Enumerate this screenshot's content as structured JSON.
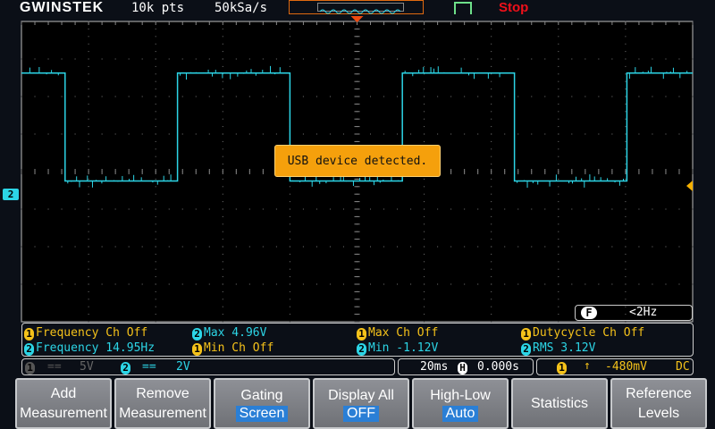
{
  "header": {
    "brand": "GWINSTEK",
    "record_length": "10k pts",
    "sample_rate": "50kSa/s",
    "run_state": "Stop"
  },
  "notification": "USB device detected.",
  "channel_marker": "2",
  "filter": {
    "icon": "F",
    "value": "<2Hz"
  },
  "measurements": [
    {
      "ch": "1",
      "text": "Frequency Ch Off",
      "color": "#f5c21a"
    },
    {
      "ch": "2",
      "text": "Max 4.96V",
      "color": "#2cd5e6"
    },
    {
      "ch": "1",
      "text": "Max Ch Off",
      "color": "#f5c21a"
    },
    {
      "ch": "1",
      "text": "Dutycycle Ch Off",
      "color": "#f5c21a"
    },
    {
      "ch": "2",
      "text": "Frequency 14.95Hz",
      "color": "#2cd5e6"
    },
    {
      "ch": "1",
      "text": "Min Ch Off",
      "color": "#f5c21a"
    },
    {
      "ch": "2",
      "text": "Min -1.12V",
      "color": "#2cd5e6"
    },
    {
      "ch": "2",
      "text": "RMS 3.12V",
      "color": "#2cd5e6"
    }
  ],
  "status": {
    "ch1": {
      "num": "1",
      "coupling": "==",
      "scale": "5V"
    },
    "ch2": {
      "num": "2",
      "coupling": "==",
      "scale": "2V"
    },
    "timebase": "20ms",
    "hpos_icon": "H",
    "hpos": "0.000s",
    "trigger": {
      "source": "1",
      "slope": "rising",
      "level": "-480mV",
      "coupling": "DC"
    }
  },
  "softkeys": [
    {
      "line1": "Add",
      "line2": "Measurement"
    },
    {
      "line1": "Remove",
      "line2": "Measurement"
    },
    {
      "line1": "Gating",
      "sub": "Screen"
    },
    {
      "line1": "Display All",
      "sub": "OFF"
    },
    {
      "line1": "High-Low",
      "sub": "Auto"
    },
    {
      "line1": "Statistics"
    },
    {
      "line1": "Reference",
      "line2": "Levels"
    }
  ],
  "waveform": {
    "channel": "2",
    "color": "#2cd5e6",
    "volts_per_div": 2,
    "ms_per_div": 20,
    "high_v": 5.25,
    "low_v": -0.5,
    "start_high": true,
    "edges_ms": [
      -87,
      -53.5,
      -20,
      13.5,
      46.9,
      80.4
    ]
  }
}
